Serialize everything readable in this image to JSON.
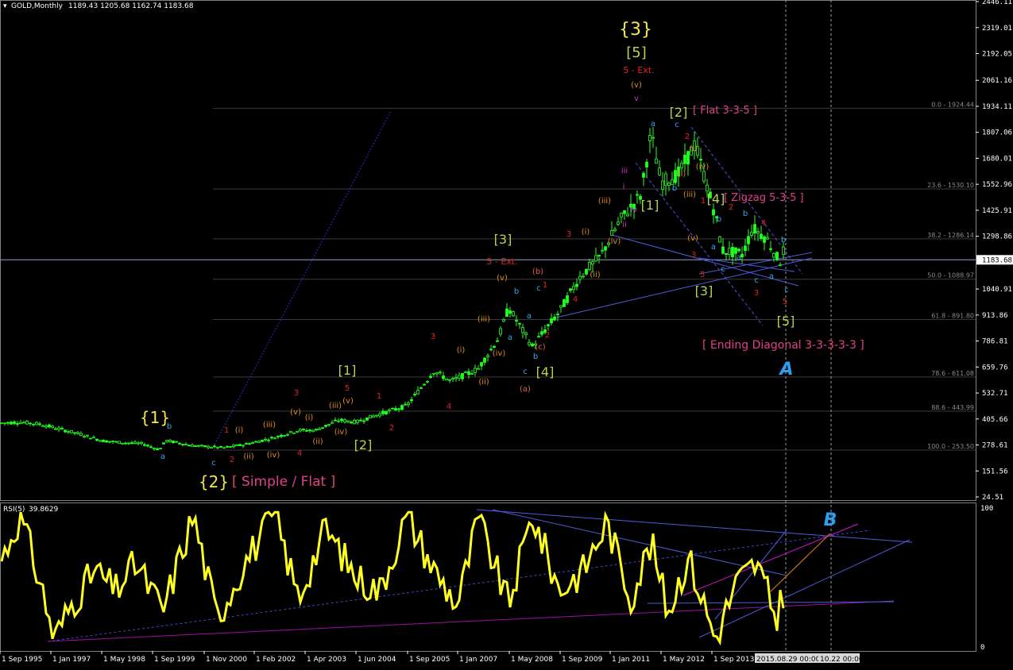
{
  "header": {
    "symbol_text": "GOLD,Monthly",
    "ohlc_text": "1189.43 1205.68 1162.74 1183.68"
  },
  "colors": {
    "background": "#000000",
    "candle": "#22ff22",
    "grid": "#3a3a3a",
    "rsi_line": "#ffff22",
    "current_price_line": "#8fa3c7",
    "trendline": "#4f5bdc",
    "magenta": "#d010d0"
  },
  "chart_data": [
    {
      "type": "line",
      "name": "price",
      "title": "GOLD,Monthly",
      "ohlc": {
        "open": 1189.43,
        "high": 1205.68,
        "low": 1162.74,
        "close": 1183.68
      },
      "current_price": 1183.68,
      "y_tick_labels": [
        "2446.11",
        "2319.01",
        "2192.05",
        "2061.16",
        "1934.11",
        "1807.06",
        "1680.01",
        "1552.96",
        "1425.91",
        "1298.86",
        "1183.68",
        "1040.91",
        "913.86",
        "786.81",
        "659.76",
        "532.71",
        "405.66",
        "278.61",
        "151.56",
        "24.51"
      ],
      "x_tick_labels": [
        "1 Sep 1995",
        "1 Jan 1997",
        "1 May 1998",
        "1 Sep 1999",
        "1 Nov 2000",
        "1 Feb 2002",
        "1 Apr 2003",
        "1 Jun 2004",
        "1 Sep 2005",
        "1 Jan 2007",
        "1 May 2008",
        "1 Sep 2009",
        "1 Jan 2011",
        "1 May 2012",
        "1 Sep 2013",
        "2015.08.29 00:00",
        "10.22 00:00"
      ],
      "x": [
        "1995-09",
        "1996-03",
        "1996-09",
        "1997-03",
        "1997-09",
        "1998-03",
        "1998-09",
        "1999-03",
        "1999-08",
        "1999-10",
        "2000-06",
        "2001-03",
        "2001-09",
        "2002-06",
        "2003-01",
        "2003-06",
        "2004-01",
        "2004-06",
        "2005-01",
        "2005-09",
        "2006-05",
        "2006-10",
        "2007-06",
        "2007-12",
        "2008-03",
        "2008-10",
        "2009-06",
        "2009-12",
        "2010-06",
        "2010-12",
        "2011-06",
        "2011-09",
        "2011-12",
        "2012-05",
        "2012-10",
        "2013-04",
        "2013-06",
        "2013-12",
        "2014-03",
        "2014-07",
        "2014-11",
        "2015-01",
        "2015-05",
        "2015-08"
      ],
      "close": [
        385,
        390,
        380,
        355,
        330,
        300,
        290,
        285,
        255,
        300,
        275,
        265,
        280,
        315,
        350,
        350,
        400,
        390,
        430,
        470,
        640,
        590,
        650,
        800,
        950,
        760,
        930,
        1100,
        1200,
        1380,
        1500,
        1800,
        1560,
        1600,
        1750,
        1400,
        1230,
        1210,
        1340,
        1290,
        1170,
        1280,
        1200,
        1183
      ],
      "fibonacci_retracements": [
        {
          "level": "0.0",
          "price": 1924.44,
          "text": "0.0 - 1924.44"
        },
        {
          "level": "23.6",
          "price": 1530.1,
          "text": "23.6 - 1530.10"
        },
        {
          "level": "38.2",
          "price": 1286.14,
          "text": "38.2 - 1286.14"
        },
        {
          "level": "50.0",
          "price": 1088.97,
          "text": "50.0 - 1088.97"
        },
        {
          "level": "61.8",
          "price": 891.8,
          "text": "61.8 - 891.80"
        },
        {
          "level": "78.6",
          "price": 611.08,
          "text": "78.6 - 611.08"
        },
        {
          "level": "88.6",
          "price": 443.99,
          "text": "88.6 - 443.99"
        },
        {
          "level": "100.0",
          "price": 253.5,
          "text": "100.0 - 253.50"
        }
      ]
    },
    {
      "type": "line",
      "name": "RSI(5)",
      "title": "RSI(5) 39.8629",
      "label": "RSI(5)",
      "value": 39.8629,
      "ylim": [
        0,
        100
      ],
      "y_tick_labels": [
        "100",
        "0"
      ],
      "x": [
        "1995-09",
        "1996-03",
        "1996-09",
        "1997-01",
        "1997-06",
        "1998-01",
        "1998-07",
        "1999-01",
        "1999-09",
        "2000-06",
        "2001-01",
        "2001-09",
        "2002-06",
        "2003-01",
        "2003-09",
        "2004-06",
        "2005-01",
        "2005-09",
        "2006-05",
        "2006-12",
        "2007-06",
        "2008-03",
        "2008-10",
        "2009-06",
        "2010-01",
        "2010-08",
        "2011-03",
        "2011-09",
        "2012-02",
        "2012-08",
        "2013-04",
        "2013-10",
        "2014-04",
        "2014-10",
        "2015-03",
        "2015-08"
      ],
      "values": [
        60,
        95,
        45,
        5,
        30,
        55,
        40,
        60,
        25,
        95,
        20,
        60,
        95,
        35,
        85,
        50,
        40,
        95,
        55,
        30,
        92,
        30,
        95,
        40,
        55,
        90,
        35,
        75,
        25,
        65,
        5,
        45,
        60,
        20,
        70,
        40
      ]
    }
  ],
  "waves": {
    "cycle_1": "{1}",
    "cycle_2": "{2}",
    "cycle_3": "{3}",
    "cycle_3_5": "[5]",
    "simple_flat": "[ Simple / Flat ]",
    "p1": "[1]",
    "p2": "[2]",
    "p3": "[3]",
    "p4": "[4]",
    "p2b": "[2]",
    "flat_335": "[ Flat 3-3-5 ]",
    "p1b": "[1]",
    "p4b": "[4]",
    "zigzag": "[ Zigzag 5-3-5 ]",
    "p3b": "[3]",
    "p5b": "[5]",
    "ending_diag": "[ Ending Diagonal 3-3-3-3-3 ]",
    "ext5_a": "5 - Ext.",
    "ext5_b": "5 - Ext.",
    "a": "a",
    "b": "b",
    "c": "c",
    "n1": "1",
    "n2": "2",
    "n3": "3",
    "n4": "4",
    "n5": "5",
    "ri": "(i)",
    "rii": "(ii)",
    "riii": "(iii)",
    "riv": "(iv)",
    "rv": "(v)",
    "ra": "(a)",
    "rb": "(b)",
    "rc": "(c)",
    "li": "i",
    "lii": "ii",
    "liii": "iii",
    "liv": "iv",
    "lv": "v",
    "big_A": "A",
    "big_B": "B"
  }
}
